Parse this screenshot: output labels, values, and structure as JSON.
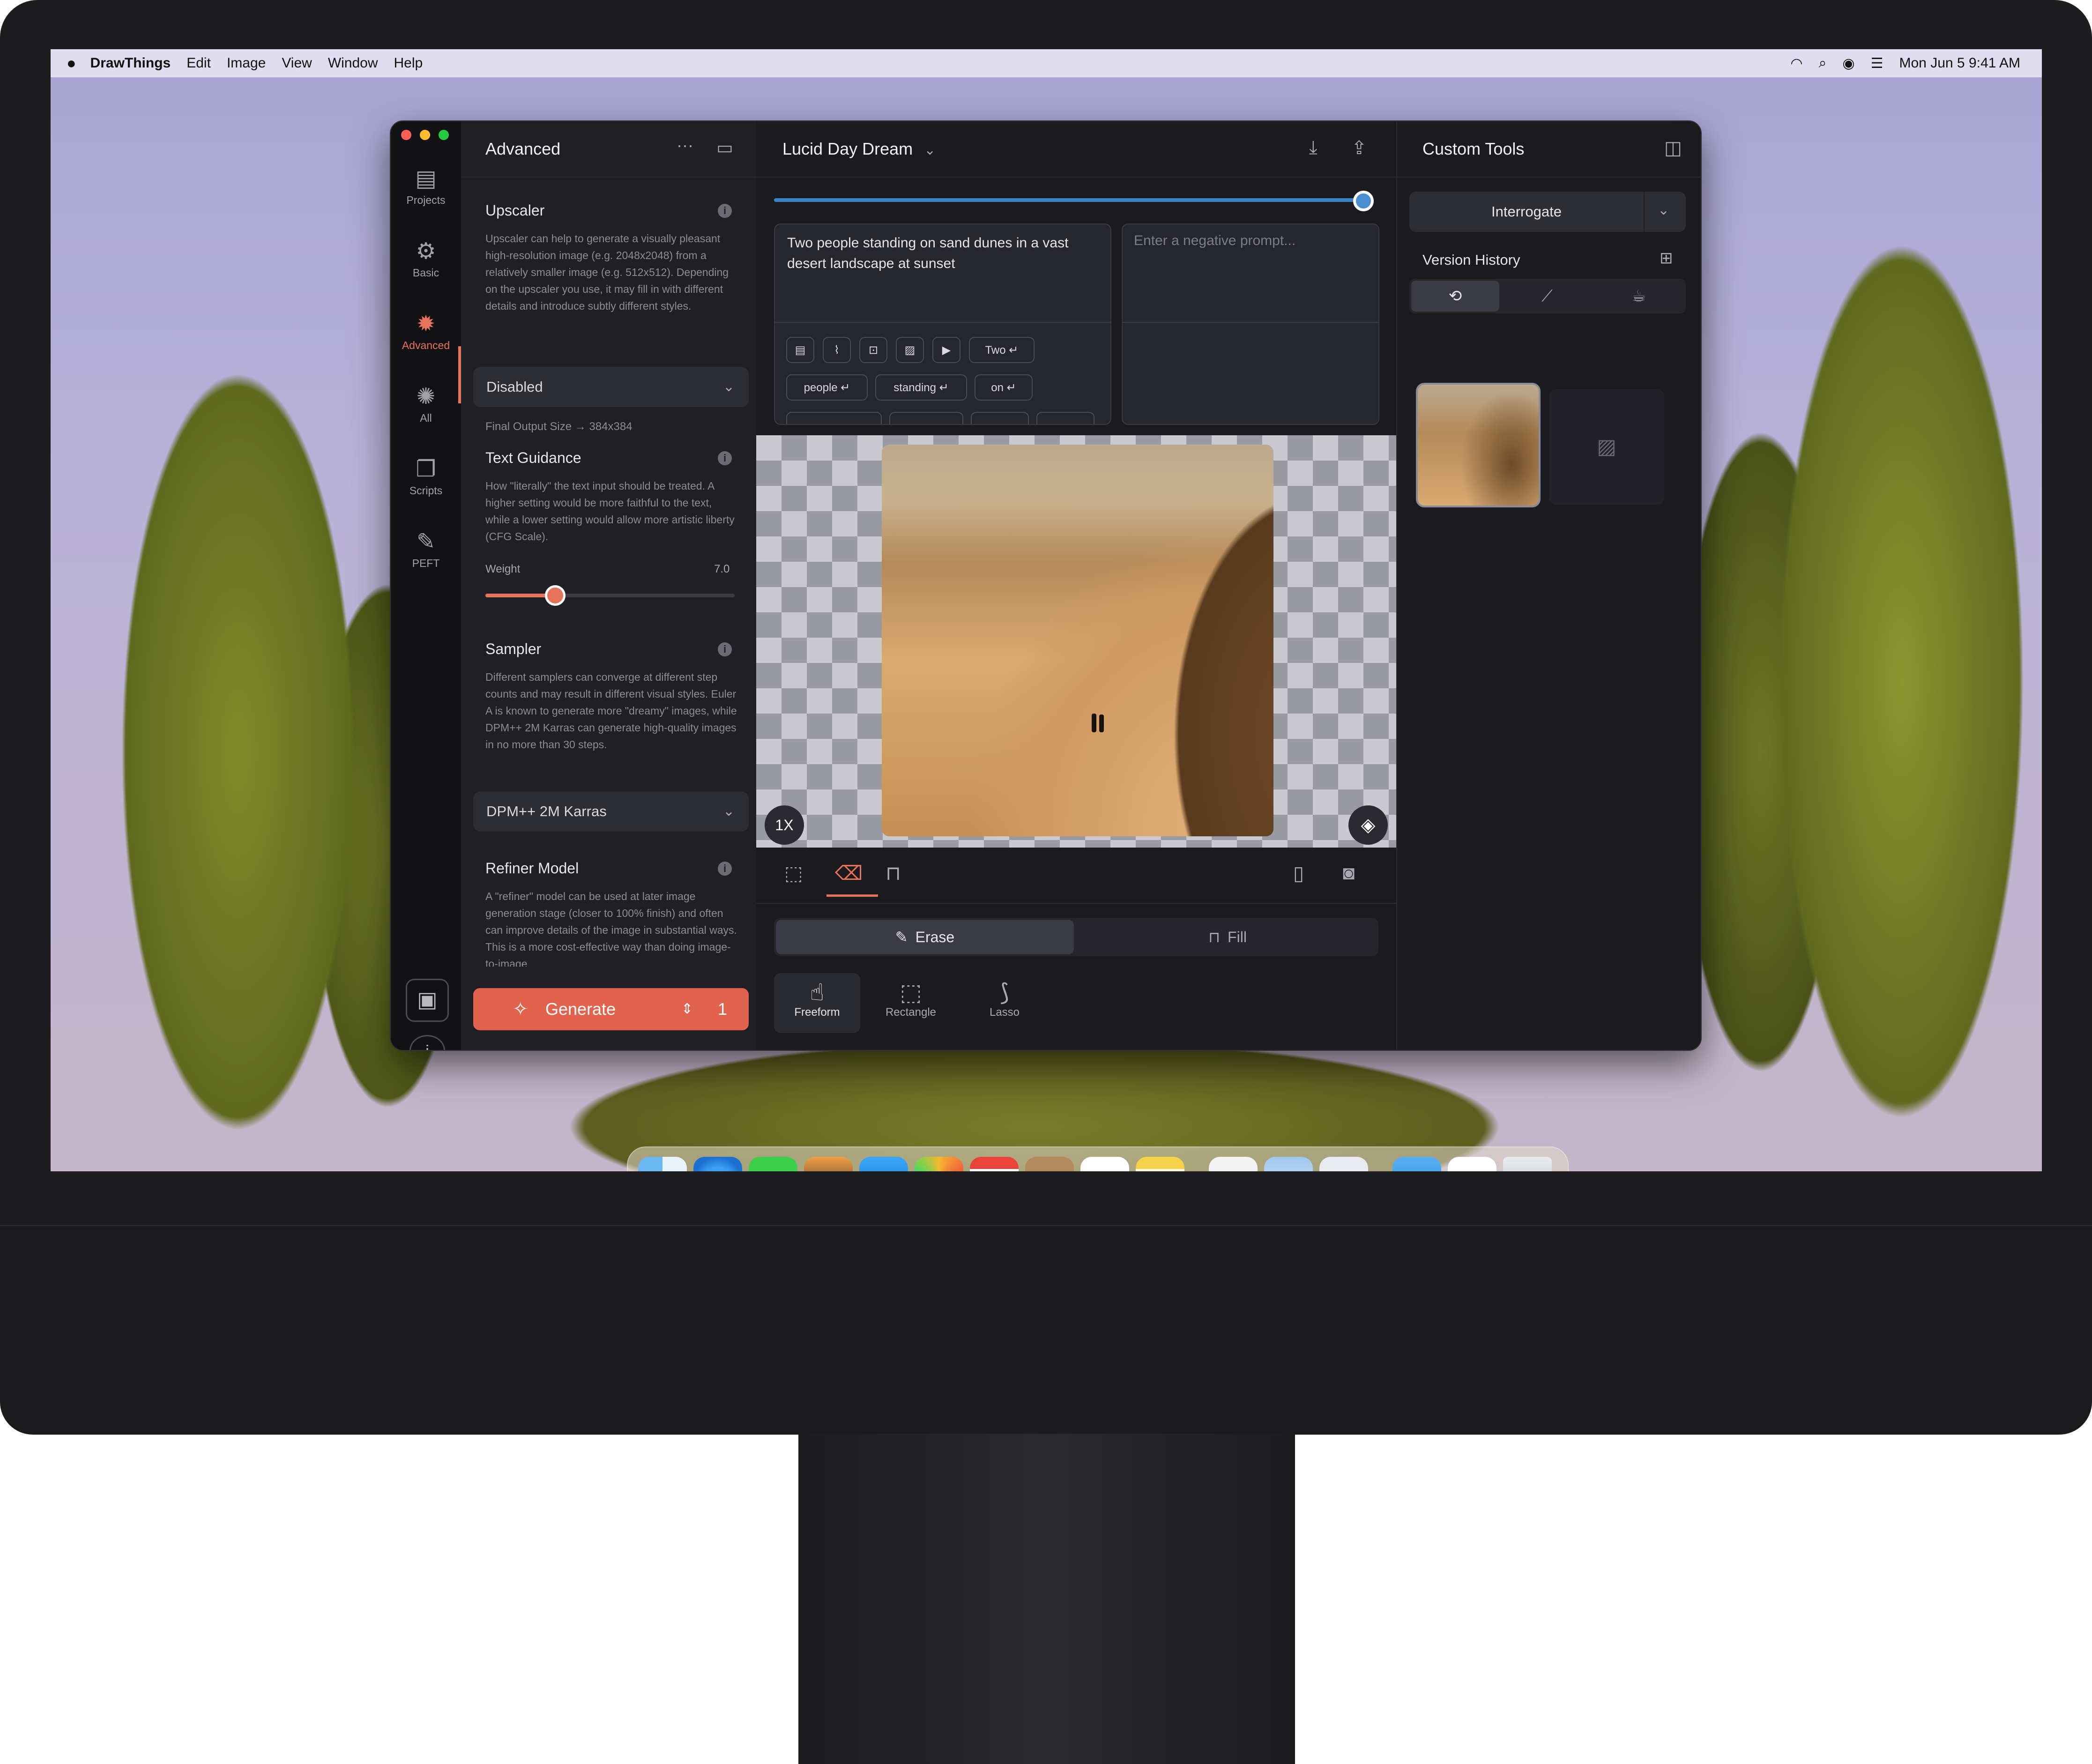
{
  "menubar": {
    "app": "DrawThings",
    "items": [
      "Edit",
      "Image",
      "View",
      "Window",
      "Help"
    ],
    "clock": "Mon Jun 5  9:41 AM"
  },
  "rail": {
    "items": [
      {
        "label": "Projects",
        "icon": "projects-icon"
      },
      {
        "label": "Basic",
        "icon": "basic-gear-icon"
      },
      {
        "label": "Advanced",
        "icon": "advanced-gear-icon"
      },
      {
        "label": "All",
        "icon": "all-gear-icon"
      },
      {
        "label": "Scripts",
        "icon": "scripts-icon"
      },
      {
        "label": "PEFT",
        "icon": "peft-icon"
      }
    ],
    "active": "Advanced"
  },
  "left": {
    "title": "Advanced",
    "upscaler": {
      "title": "Upscaler",
      "desc": "Upscaler can help to generate a visually pleasant high-resolution image (e.g. 2048x2048) from a relatively smaller image (e.g. 512x512). Depending on the upscaler you use, it may fill in with different details and introduce subtly different styles.",
      "value": "Disabled",
      "output": "Final Output Size → 384x384"
    },
    "guidance": {
      "title": "Text Guidance",
      "desc": "How \"literally\" the text input should be treated. A higher setting would be more faithful to the text, while a lower setting would allow more artistic liberty (CFG Scale).",
      "weight_label": "Weight",
      "weight_value": "7.0",
      "slider_fraction": 0.28
    },
    "sampler": {
      "title": "Sampler",
      "desc": "Different samplers can converge at different step counts and may result in different visual styles. Euler A is known to generate more \"dreamy\" images, while DPM++ 2M Karras can generate high-quality images in no more than 30 steps.",
      "value": "DPM++ 2M Karras"
    },
    "refiner": {
      "title": "Refiner Model",
      "desc": "A \"refiner\" model can be used at later image generation stage (closer to 100% finish) and often can improve details of the image in substantial ways. This is a more cost-effective way than doing image-to-image"
    },
    "generate": {
      "label": "Generate",
      "count": "1"
    }
  },
  "center": {
    "title": "Lucid Day Dream",
    "progress_fraction": 1.0,
    "prompt": "Two people standing on sand dunes in a vast desert landscape at sunset",
    "negative_placeholder": "Enter a negative prompt...",
    "token_chips": [
      "Two",
      "people",
      "standing",
      "on"
    ],
    "zoom": "1X",
    "modes": {
      "erase": "Erase",
      "fill": "Fill"
    },
    "tools": [
      "Freeform",
      "Rectangle",
      "Lasso"
    ]
  },
  "right": {
    "title": "Custom Tools",
    "interrogate": "Interrogate",
    "history_title": "Version History"
  },
  "colors": {
    "accent": "#e8735d",
    "panel": "#1f1f24",
    "progress": "#3b82c4"
  }
}
